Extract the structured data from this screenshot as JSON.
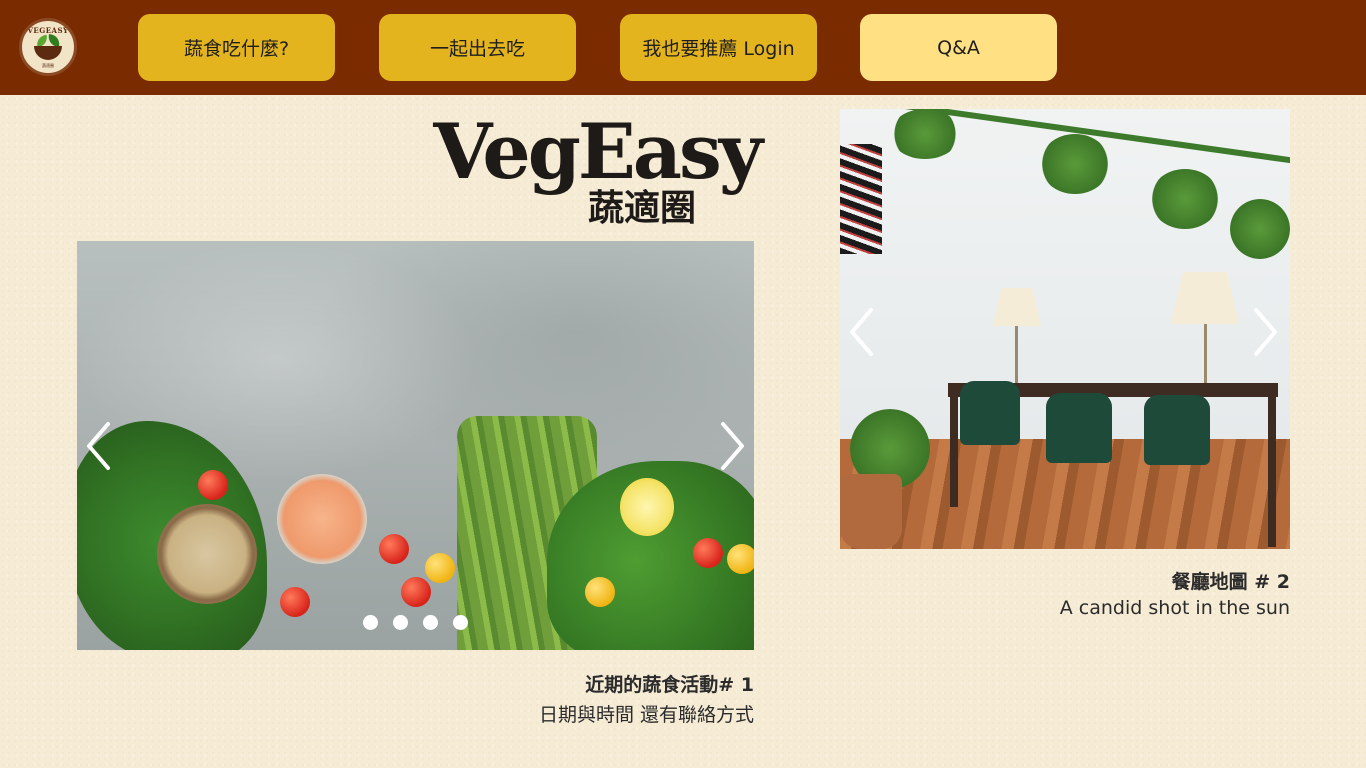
{
  "header": {
    "logo_text": "VEGEASY",
    "logo_sub": "蔬適圈",
    "nav": [
      {
        "label": "蔬食吃什麼?"
      },
      {
        "label": "一起出去吃"
      },
      {
        "label": "我也要推薦 Login"
      },
      {
        "label": "Q&A"
      }
    ]
  },
  "brand": {
    "name": "VegEasy",
    "sub": "蔬適圈"
  },
  "carousel1": {
    "caption_title": "近期的蔬食活動# 1",
    "caption_sub": "日期與時間  還有聯絡方式",
    "slide_count": 4,
    "active_slide": 1
  },
  "carousel2": {
    "caption_title": "餐廳地圖 # 2",
    "caption_sub": "A candid shot in the sun"
  },
  "icons": {
    "prev": "chevron-left-icon",
    "next": "chevron-right-icon"
  },
  "colors": {
    "header_bg": "#7b2b00",
    "nav_button": "#e4b41f",
    "nav_button_alt": "#ffe082",
    "page_bg": "#f6ecd6"
  }
}
